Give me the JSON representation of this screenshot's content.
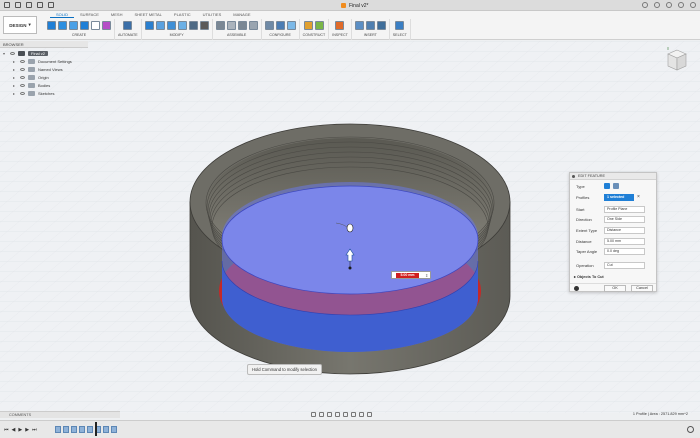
{
  "window": {
    "title": "Final v2*"
  },
  "workspace": {
    "label": "DESIGN"
  },
  "tabs": [
    "SOLID",
    "SURFACE",
    "MESH",
    "SHEET METAL",
    "PLASTIC",
    "UTILITIES",
    "MANAGE"
  ],
  "active_tab": "SOLID",
  "groups": [
    {
      "label": "CREATE",
      "icons": [
        "#1f7fd6",
        "#2c8fe0",
        "#4aa0e6",
        "#1f7fd6",
        "#ffffff",
        "#b54ec6"
      ]
    },
    {
      "label": "AUTOMATE",
      "icons": [
        "#3b6fa8"
      ]
    },
    {
      "label": "MODIFY",
      "icons": [
        "#2a7fcf",
        "#5aa1e0",
        "#3f8fd6",
        "#6bb0e6",
        "#4e6a85",
        "#5a5a5a"
      ]
    },
    {
      "label": "ASSEMBLE",
      "icons": [
        "#7a8794",
        "#aab3bc",
        "#7a8794",
        "#9aa5b0"
      ]
    },
    {
      "label": "CONFIGURE",
      "icons": [
        "#6f8aa6",
        "#4c7db3",
        "#7cb9e8"
      ]
    },
    {
      "label": "CONSTRUCT",
      "icons": [
        "#e0a030",
        "#7ab648"
      ]
    },
    {
      "label": "INSPECT",
      "icons": [
        "#e06b2a"
      ]
    },
    {
      "label": "INSERT",
      "icons": [
        "#5a8ec4",
        "#4f7fb0",
        "#3f6e9a"
      ]
    },
    {
      "label": "SELECT",
      "icons": [
        "#3a7fc4"
      ]
    }
  ],
  "browser": {
    "header": "BROWSER",
    "root": "Final v2",
    "items": [
      "Document Settings",
      "Named Views",
      "Origin",
      "Bodies",
      "Sketches"
    ]
  },
  "edit_feature": {
    "title": "EDIT FEATURE",
    "type_label": "Type",
    "profiles_label": "Profiles",
    "profiles_value": "1 selected",
    "start_label": "Start",
    "start_value": "Profile Plane",
    "direction_label": "Direction",
    "direction_value": "One Side",
    "extent_label": "Extent Type",
    "extent_value": "Distance",
    "distance_label": "Distance",
    "distance_value": "5.00 mm",
    "taper_label": "Taper Angle",
    "taper_value": "0.0 deg",
    "operation_label": "Operation",
    "operation_value": "Cut",
    "objects_label": "Objects To Cut",
    "ok": "OK",
    "cancel": "Cancel"
  },
  "distance_popup": {
    "value": "5.00 mm"
  },
  "tooltip": "Hold Command to modify selection",
  "comments_label": "COMMENTS",
  "status": "1 Profile | Area : 2571.829 mm^2",
  "colors": {
    "accent": "#1f7fd6",
    "profile": "#4f5fd8",
    "cut_ring": "#c02a2a",
    "body": "#6b6a63"
  }
}
